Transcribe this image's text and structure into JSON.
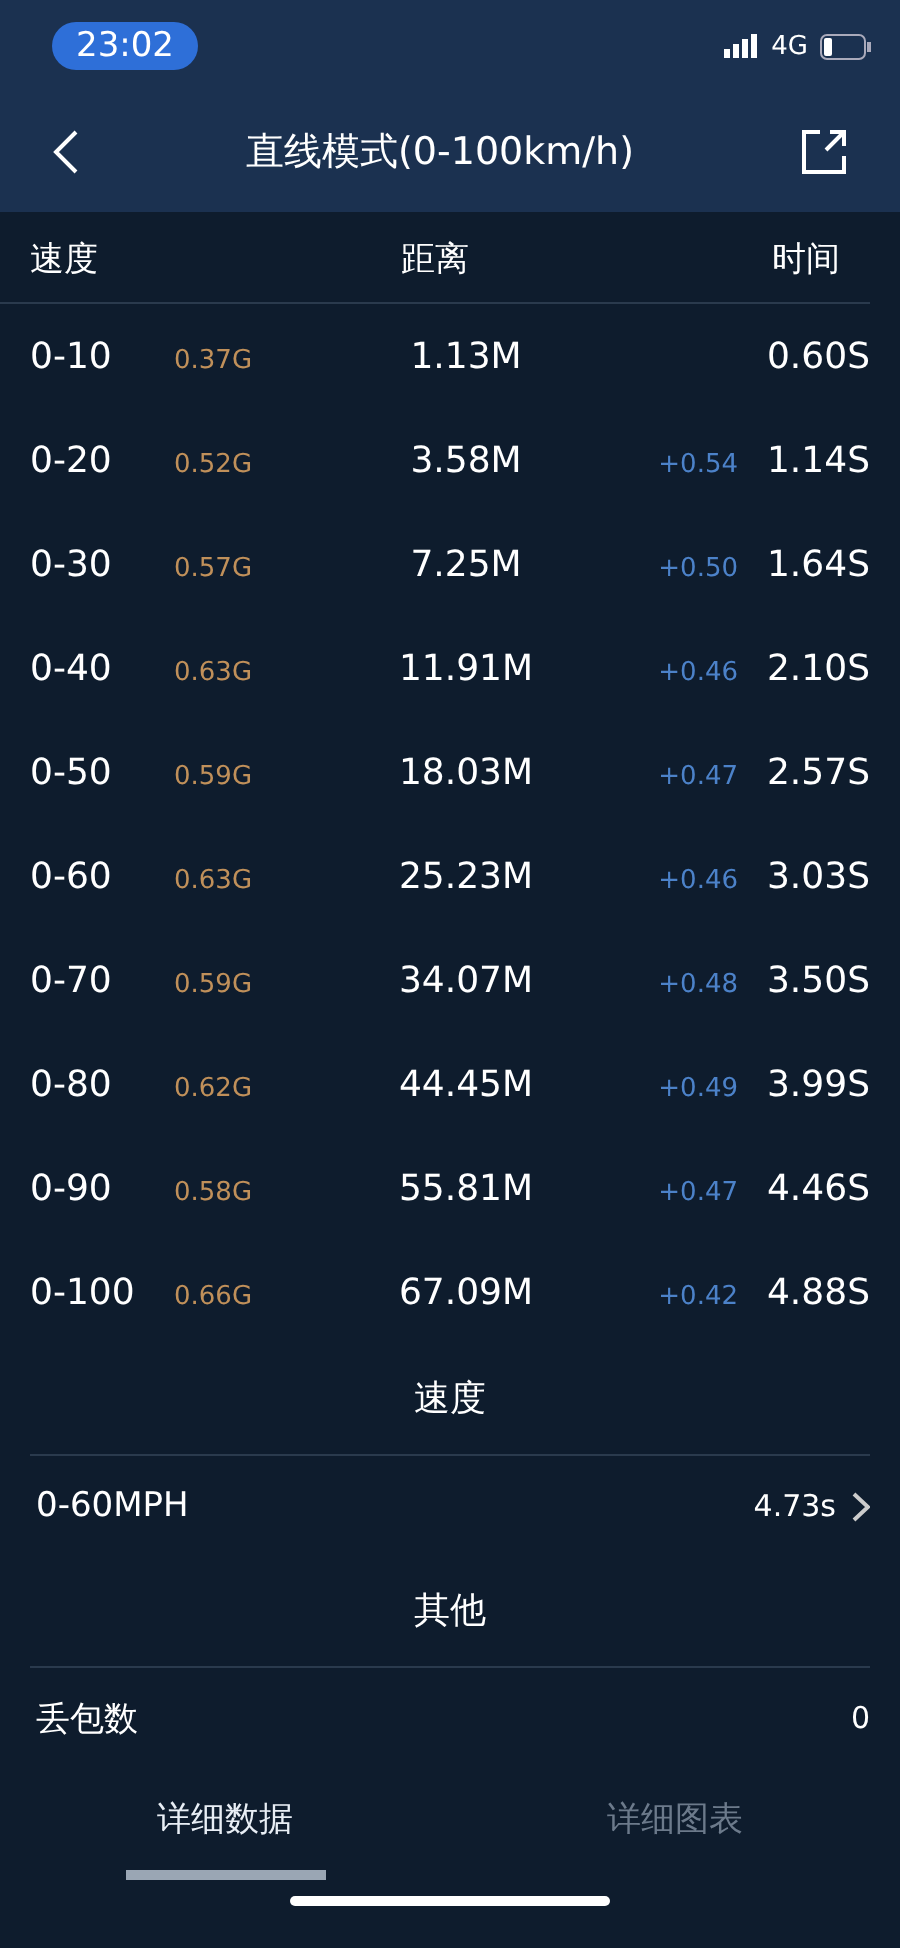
{
  "status_bar": {
    "time": "23:02",
    "network": "4G"
  },
  "nav": {
    "title": "直线模式(0-100km/h)"
  },
  "table": {
    "columns": [
      "速度",
      "距离",
      "时间"
    ],
    "rows": [
      {
        "speed": "0-10",
        "g": "0.37G",
        "distance": "1.13M",
        "time": "0.60S"
      },
      {
        "speed": "0-20",
        "g": "0.52G",
        "distance": "3.58M",
        "delta": "+0.54",
        "time": "1.14S"
      },
      {
        "speed": "0-30",
        "g": "0.57G",
        "distance": "7.25M",
        "delta": "+0.50",
        "time": "1.64S"
      },
      {
        "speed": "0-40",
        "g": "0.63G",
        "distance": "11.91M",
        "delta": "+0.46",
        "time": "2.10S"
      },
      {
        "speed": "0-50",
        "g": "0.59G",
        "distance": "18.03M",
        "delta": "+0.47",
        "time": "2.57S"
      },
      {
        "speed": "0-60",
        "g": "0.63G",
        "distance": "25.23M",
        "delta": "+0.46",
        "time": "3.03S"
      },
      {
        "speed": "0-70",
        "g": "0.59G",
        "distance": "34.07M",
        "delta": "+0.48",
        "time": "3.50S"
      },
      {
        "speed": "0-80",
        "g": "0.62G",
        "distance": "44.45M",
        "delta": "+0.49",
        "time": "3.99S"
      },
      {
        "speed": "0-90",
        "g": "0.58G",
        "distance": "55.81M",
        "delta": "+0.47",
        "time": "4.46S"
      },
      {
        "speed": "0-100",
        "g": "0.66G",
        "distance": "67.09M",
        "delta": "+0.42",
        "time": "4.88S"
      }
    ]
  },
  "sections": [
    {
      "title": "速度",
      "items": [
        {
          "label": "0-60MPH",
          "value": "4.73s",
          "link": true
        }
      ]
    },
    {
      "title": "其他",
      "items": [
        {
          "label": "丢包数",
          "value": "0",
          "link": false
        }
      ]
    }
  ],
  "tabs": [
    {
      "label": "详细数据",
      "selected": true
    },
    {
      "label": "详细图表",
      "selected": false
    }
  ]
}
